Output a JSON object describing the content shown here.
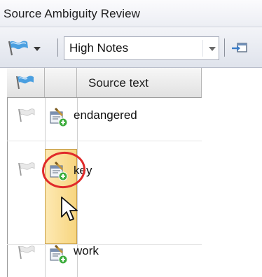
{
  "window": {
    "title": "Source Ambiguity Review"
  },
  "toolbar": {
    "flag_menu_icon": "flag-icon",
    "filter_combo": {
      "selected": "High Notes"
    },
    "pin_icon": "pin-icon"
  },
  "grid": {
    "columns": [
      {
        "kind": "flag-icon",
        "label": ""
      },
      {
        "kind": "note-icon",
        "label": ""
      },
      {
        "kind": "text",
        "label": "Source text"
      }
    ],
    "rows": [
      {
        "flag": "flag-icon",
        "icon": "add-note-icon",
        "source_text": "endangered",
        "selected": false
      },
      {
        "flag": "flag-icon",
        "icon": "add-note-icon",
        "source_text": "key",
        "selected": true
      },
      {
        "flag": "flag-icon",
        "icon": "add-note-icon",
        "source_text": "work",
        "selected": false
      }
    ]
  },
  "colors": {
    "selection": "#f7d57f",
    "highlight_circle": "#e02a2a"
  }
}
